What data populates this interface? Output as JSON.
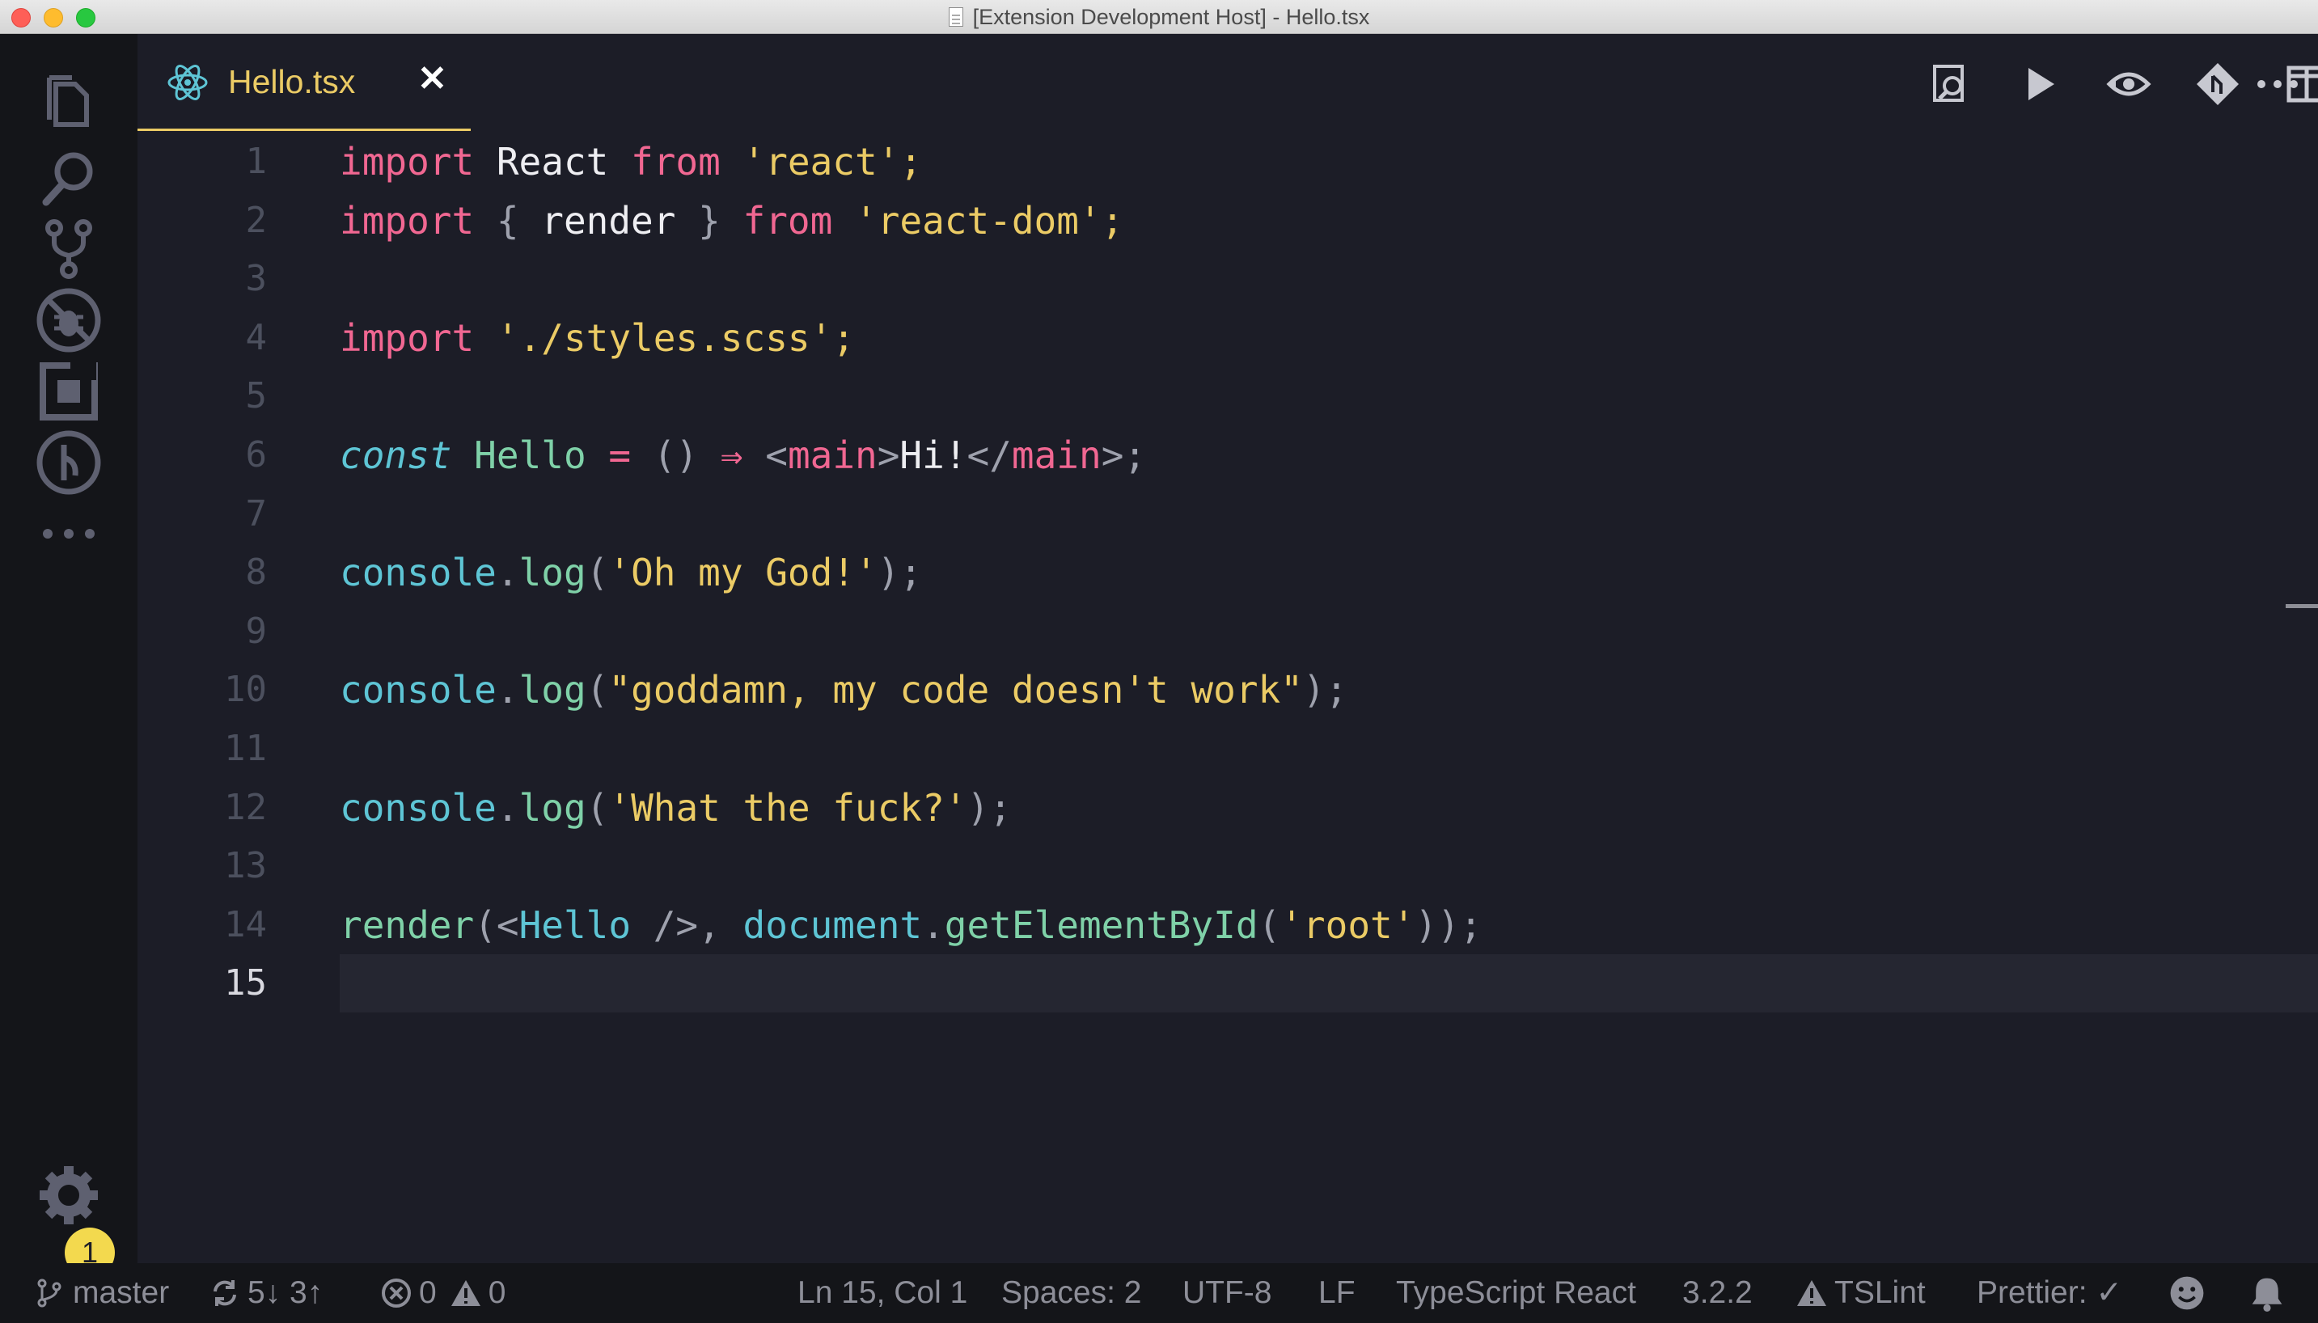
{
  "window": {
    "title": "[Extension Development Host] - Hello.tsx"
  },
  "tab": {
    "label": "Hello.tsx",
    "close_glyph": "✕"
  },
  "activity_bar": {
    "icons": [
      "files-icon",
      "search-icon",
      "source-control-icon",
      "debug-disabled-icon",
      "extensions-icon",
      "timeline-icon",
      "more-icon",
      "gear-icon"
    ],
    "badge": "1"
  },
  "toolbar": {
    "icons": [
      "find-in-preview-icon",
      "run-icon",
      "open-changes-icon",
      "git-compare-icon",
      "split-editor-icon",
      "more-actions-icon"
    ]
  },
  "editor": {
    "line_numbers": [
      "1",
      "2",
      "3",
      "4",
      "5",
      "6",
      "7",
      "8",
      "9",
      "10",
      "11",
      "12",
      "13",
      "14",
      "15"
    ],
    "active_line": 15,
    "lines": {
      "l1": {
        "a": "import",
        "b": " React ",
        "c": "from",
        "d": " 'react';"
      },
      "l2": {
        "a": "import",
        "b": " { ",
        "c": "render",
        "d": " } ",
        "e": "from",
        "f": " 'react-dom';"
      },
      "l4": {
        "a": "import",
        "b": " './styles.scss';"
      },
      "l6": {
        "a": "const",
        "b": " Hello",
        "c": " = ",
        "d": "() ",
        "e": "⇒",
        "f": " <",
        "g": "main",
        "h": ">",
        "i": "Hi!",
        "j": "</",
        "k": "main",
        "l": ">;"
      },
      "l8": {
        "a": "console",
        "b": ".",
        "c": "log",
        "d": "(",
        "e": "'Oh my God!'",
        "f": ");"
      },
      "l10": {
        "a": "console",
        "b": ".",
        "c": "log",
        "d": "(",
        "e": "\"goddamn, my code doesn't work\"",
        "f": ");"
      },
      "l12": {
        "a": "console",
        "b": ".",
        "c": "log",
        "d": "(",
        "e": "'What the fuck?'",
        "f": ");"
      },
      "l14": {
        "a": "render",
        "b": "(<",
        "c": "Hello",
        "d": " />, ",
        "e": "document",
        "f": ".",
        "g": "getElementById",
        "h": "(",
        "i": "'root'",
        "j": "));"
      }
    }
  },
  "status_bar": {
    "branch": "master",
    "sync": "5↓ 3↑",
    "errors": "0",
    "warnings": "0",
    "position": "Ln 15, Col 1",
    "spaces": "Spaces: 2",
    "encoding": "UTF-8",
    "eol": "LF",
    "language": "TypeScript React",
    "version": "3.2.2",
    "linter": "TSLint",
    "prettier": "Prettier: ✓"
  },
  "colors": {
    "editor_bg": "#1c1d27",
    "sidebar_bg": "#141519",
    "keyword": "#f16792",
    "string": "#ebcb65",
    "function": "#5ec5d5",
    "class": "#7fd1a8",
    "badge": "#f3d94e"
  }
}
